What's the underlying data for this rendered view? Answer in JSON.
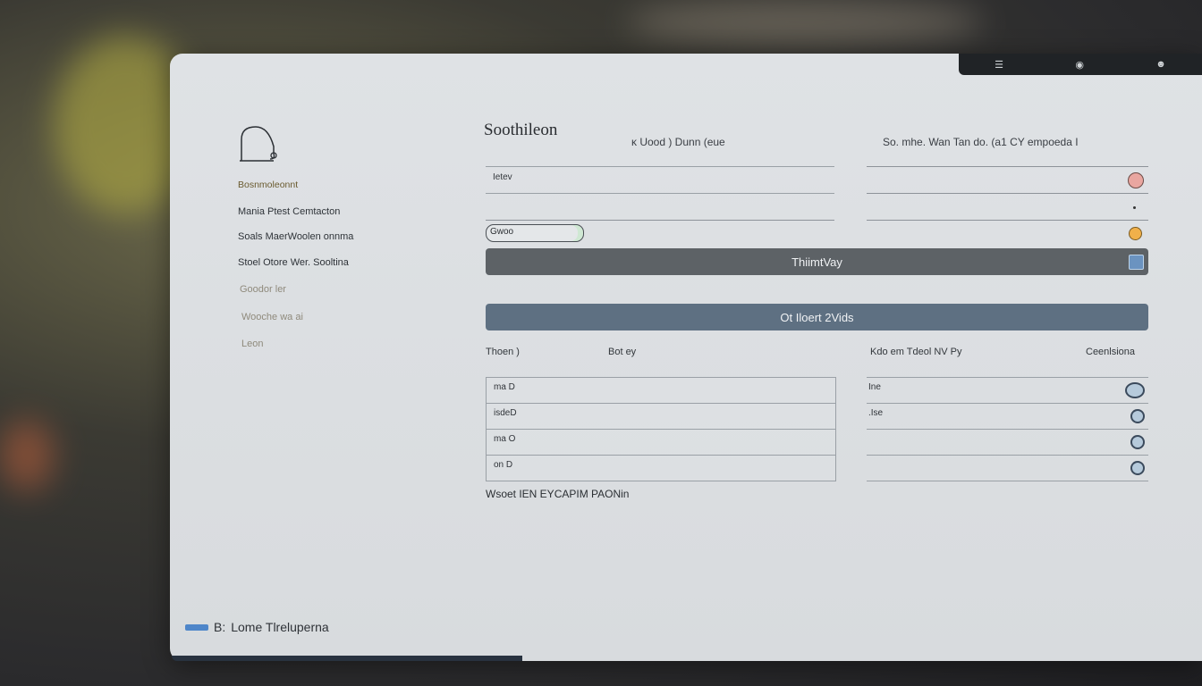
{
  "window": {
    "title": "Soothileon",
    "subtitle_left": "ᴋ Uood ) Dunn (eue",
    "subtitle_right": "So. mhe. Wan Tan do. (a1 CY empoeda I"
  },
  "topbar": {
    "icons": [
      "menu-icon",
      "camera-icon",
      "user-icon"
    ]
  },
  "sidebar": {
    "items": [
      {
        "label": "Bosnmoleonnt"
      },
      {
        "label": "Mania Ptest Cemtacton"
      },
      {
        "label": "Soals MaerWoolen onnma"
      },
      {
        "label": "Stoel Otore Wer. Sooltina"
      },
      {
        "label": "Goodor ler"
      },
      {
        "label": "Wooche wa ai"
      },
      {
        "label": "Leon"
      }
    ]
  },
  "form": {
    "field1_label": "Ietev",
    "pill_label": "Gwoo",
    "bar1_label": "ThiimtVay",
    "bar2_label": "Ot Iloert 2Vids"
  },
  "table": {
    "headers": [
      "Thoen )",
      "Bot ey",
      "Kdo em Tdeol NV Py",
      "Ceenlsiona"
    ],
    "rows_left": [
      "ma D",
      "isdeD",
      "ma O",
      "on D"
    ],
    "rows_right": [
      "Ine",
      ".Ise",
      "",
      ""
    ]
  },
  "footnote": "Wsoet IEN EYCAPIM PAONin",
  "status": {
    "label": "B:",
    "text": "Lome Tlreluperna"
  },
  "colors": {
    "accent_blue": "#4e86c9",
    "bar_dark": "#5d6266",
    "bar_slate": "#5e7082",
    "dot_pink": "#e9a6a0",
    "dot_orange": "#f0b04a"
  }
}
